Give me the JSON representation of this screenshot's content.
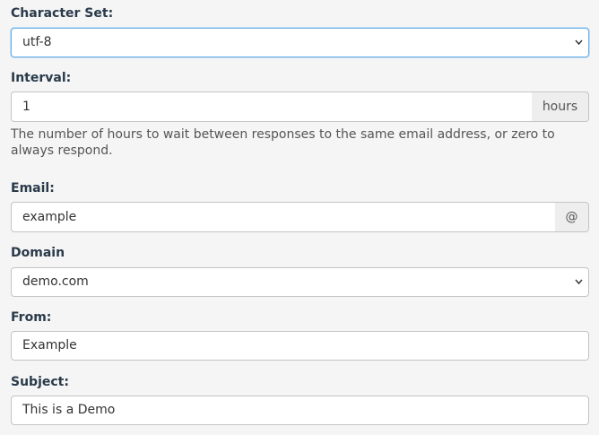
{
  "charset": {
    "label": "Character Set:",
    "value": "utf-8"
  },
  "interval": {
    "label": "Interval:",
    "value": "1",
    "addon": "hours",
    "help": "The number of hours to wait between responses to the same email address, or zero to always respond."
  },
  "email": {
    "label": "Email:",
    "value": "example",
    "addon": "@"
  },
  "domain": {
    "label": "Domain",
    "value": "demo.com"
  },
  "from": {
    "label": "From:",
    "value": "Example"
  },
  "subject": {
    "label": "Subject:",
    "value": "This is a Demo"
  },
  "icons": {
    "select_arrow": "chevron-down-icon"
  }
}
